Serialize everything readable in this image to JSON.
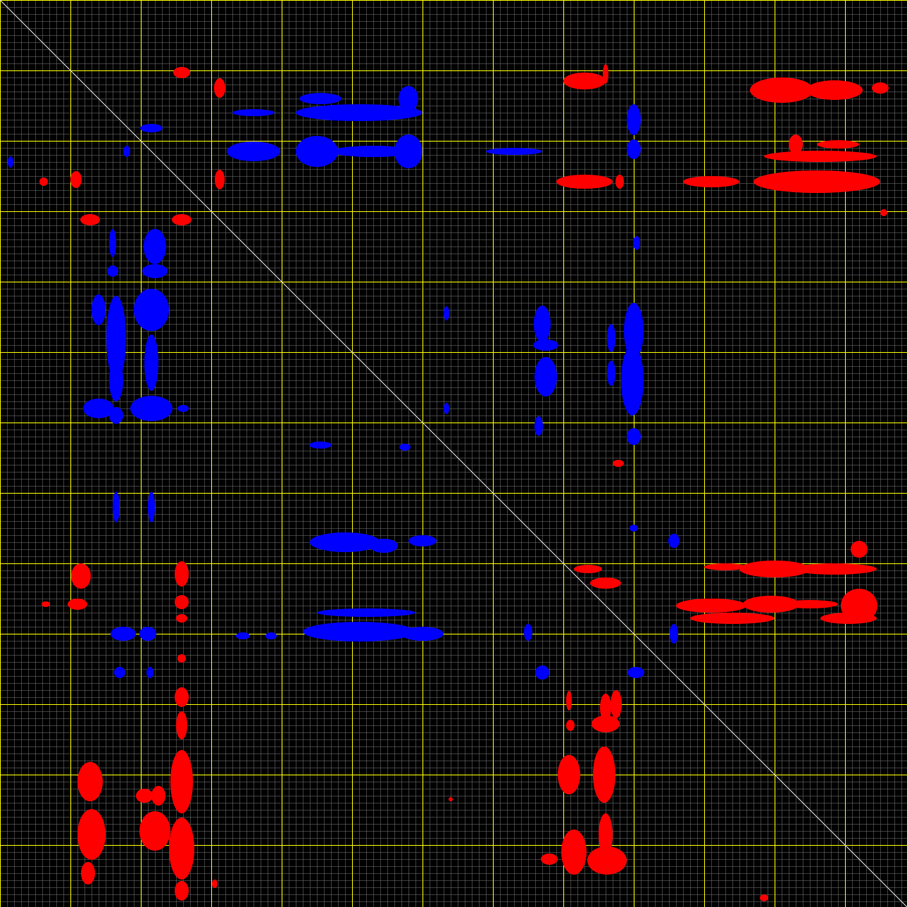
{
  "plot": {
    "type": "contact-map",
    "background_color": "#000000",
    "minor_grid_color": "#7a7a7a",
    "major_grid_color": "#ffff00",
    "diagonal_color": "#cccccc",
    "positive_color": "#ff0000",
    "negative_color": "#0000ff",
    "minor_grid_divisions": 129,
    "major_grid_divisions": 13,
    "description": ""
  }
}
